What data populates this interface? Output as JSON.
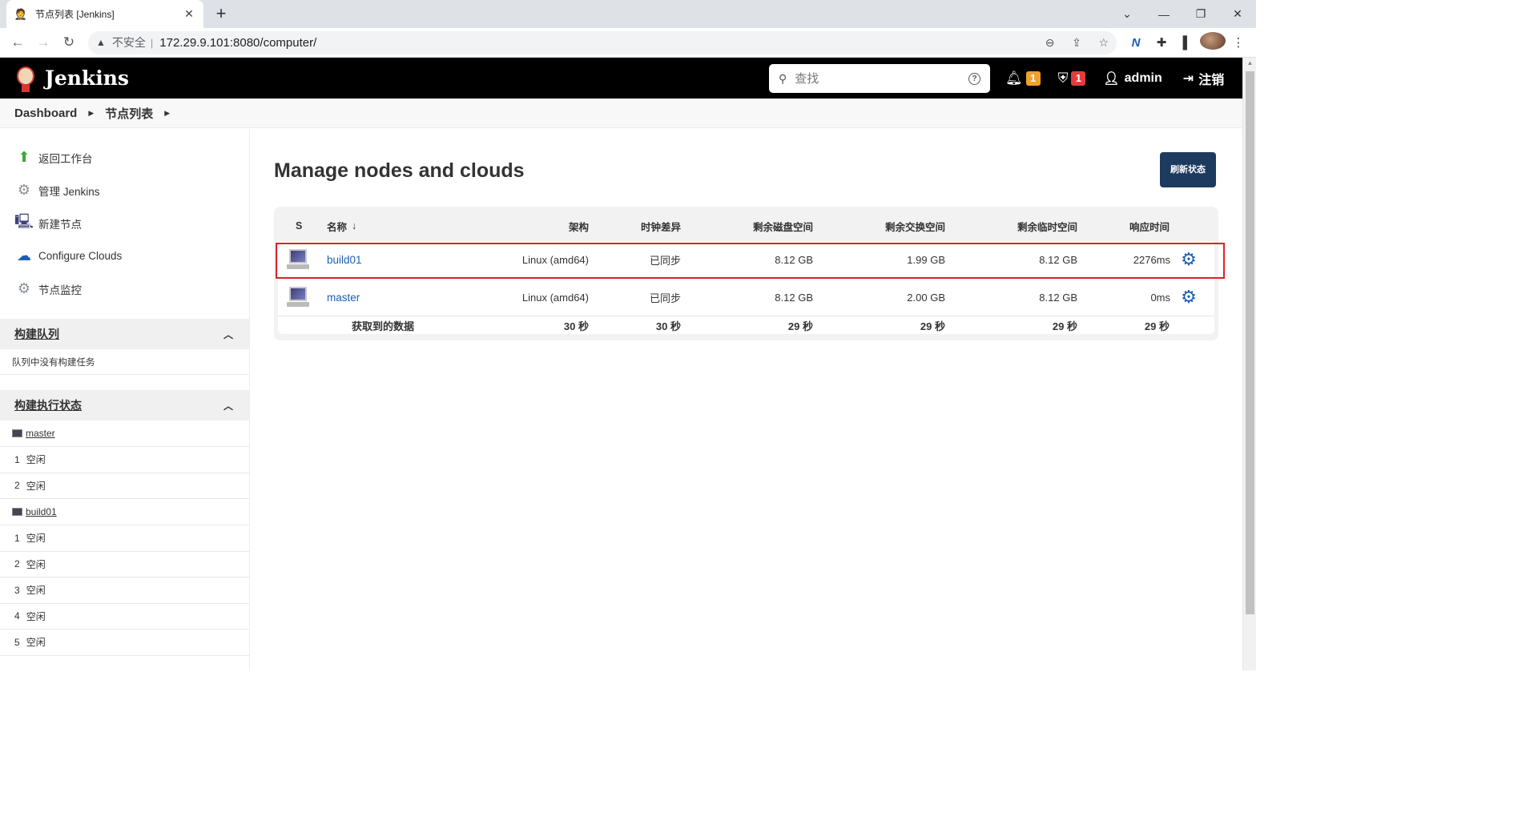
{
  "browser": {
    "tab_title": "节点列表 [Jenkins]",
    "url": "172.29.9.101:8080/computer/",
    "insecure_label": "不安全",
    "warn_icon": "warning-icon"
  },
  "header": {
    "title": "Jenkins",
    "search_placeholder": "查找",
    "notifications_count": "1",
    "security_count": "1",
    "user": "admin",
    "logout": "注销"
  },
  "breadcrumb": {
    "items": [
      "Dashboard",
      "节点列表"
    ]
  },
  "sidebar": {
    "tasks": [
      {
        "label": "返回工作台",
        "icon": "up-arrow-icon"
      },
      {
        "label": "管理 Jenkins",
        "icon": "gear-icon"
      },
      {
        "label": "新建节点",
        "icon": "computer-new-icon"
      },
      {
        "label": "Configure Clouds",
        "icon": "cloud-icon"
      },
      {
        "label": "节点监控",
        "icon": "gear-icon"
      }
    ],
    "queue": {
      "title": "构建队列",
      "empty_text": "队列中没有构建任务"
    },
    "executors": {
      "title": "构建执行状态",
      "nodes": [
        {
          "name": "master",
          "executors": [
            {
              "num": "1",
              "status": "空闲"
            },
            {
              "num": "2",
              "status": "空闲"
            }
          ]
        },
        {
          "name": "build01",
          "executors": [
            {
              "num": "1",
              "status": "空闲"
            },
            {
              "num": "2",
              "status": "空闲"
            },
            {
              "num": "3",
              "status": "空闲"
            },
            {
              "num": "4",
              "status": "空闲"
            },
            {
              "num": "5",
              "status": "空闲"
            }
          ]
        }
      ]
    }
  },
  "main": {
    "title": "Manage nodes and clouds",
    "refresh_button": "刷新状态",
    "table": {
      "headers": {
        "s": "S",
        "name": "名称",
        "sort_indicator": "↓",
        "arch": "架构",
        "clock": "时钟差异",
        "disk": "剩余磁盘空间",
        "swap": "剩余交换空间",
        "temp": "剩余临时空间",
        "response": "响应时间"
      },
      "rows": [
        {
          "name": "build01",
          "arch": "Linux (amd64)",
          "clock": "已同步",
          "disk": "8.12 GB",
          "swap": "1.99 GB",
          "temp": "8.12 GB",
          "response": "2276ms"
        },
        {
          "name": "master",
          "arch": "Linux (amd64)",
          "clock": "已同步",
          "disk": "8.12 GB",
          "swap": "2.00 GB",
          "temp": "8.12 GB",
          "response": "0ms"
        }
      ],
      "footer": {
        "label": "获取到的数据",
        "arch": "30 秒",
        "clock": "30 秒",
        "disk": "29 秒",
        "swap": "29 秒",
        "temp": "29 秒",
        "response": "29 秒"
      }
    }
  },
  "colors": {
    "header_bg": "#000000",
    "link": "#1b5eb8",
    "highlight": "#e0202a",
    "button_bg": "#1d3a5f",
    "badge_orange": "#f0a030",
    "badge_red": "#e43c3c"
  }
}
